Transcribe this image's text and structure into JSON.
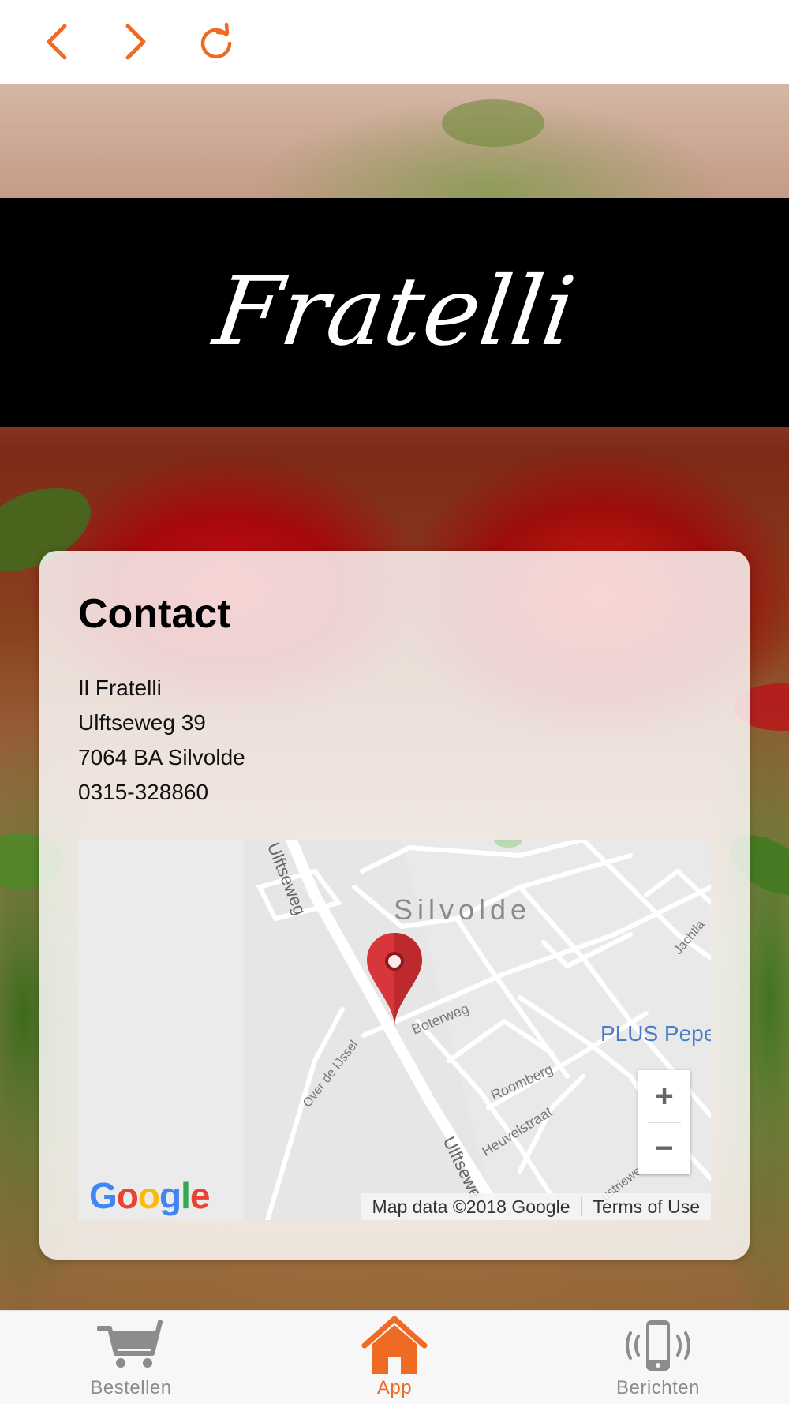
{
  "colors": {
    "accent": "#ef6a23",
    "logo_band": "#000000",
    "tab_inactive": "#8c8c8c",
    "map_pin": "#d8363a",
    "poi_link": "#4b7bc6"
  },
  "toolbar": {
    "back_icon": "chevron-left-icon",
    "forward_icon": "chevron-right-icon",
    "reload_icon": "reload-icon"
  },
  "header": {
    "logo_text": "Fratelli"
  },
  "contact": {
    "title": "Contact",
    "address_lines": [
      "Il Fratelli",
      "Ulftseweg 39",
      "7064 BA Silvolde",
      "0315-328860"
    ]
  },
  "map": {
    "town": "Silvolde",
    "streets": [
      "Ulftseweg",
      "Boterweg",
      "Over de IJssel",
      "Roomberg",
      "Heuvelstraat",
      "Ulftsewe",
      "Jachtla",
      "ustrieweg"
    ],
    "poi": "PLUS Pepe",
    "zoom_in": "+",
    "zoom_out": "−",
    "logo": "Google",
    "map_data": "Map data ©2018 Google",
    "terms": "Terms of Use"
  },
  "tabs": [
    {
      "label": "Bestellen",
      "icon": "cart-icon",
      "active": false
    },
    {
      "label": "App",
      "icon": "home-icon",
      "active": true
    },
    {
      "label": "Berichten",
      "icon": "phone-vibrate-icon",
      "active": false
    }
  ]
}
